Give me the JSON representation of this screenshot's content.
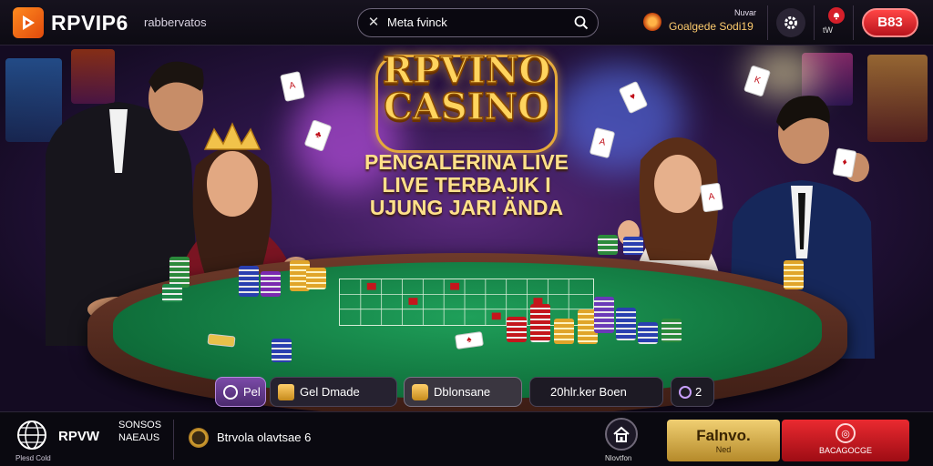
{
  "header": {
    "brand": "RPVIP6",
    "brand_sub": "rabbervatos",
    "search_value": "Meta fvinck",
    "promo_top": "Nuvar",
    "promo_text": "Goalgede Sodi19",
    "bell_label": "tW",
    "pill_label": "B83"
  },
  "hero": {
    "title_line1": "RPVINO",
    "title_line2": "CASINO",
    "tagline": [
      "PENGALERINA LIVE",
      "LIVE TERBAJIK I",
      "UJUNG JARI ÄNDA"
    ],
    "buttons": [
      {
        "label": "Pel"
      },
      {
        "label": "Gel Dmade"
      },
      {
        "label": "Dblonsane"
      },
      {
        "label": "20hlr.ker Boen"
      },
      {
        "label": "2"
      }
    ]
  },
  "footer": {
    "brand": "RPVW",
    "globe_caption": "Plesd Cold",
    "col2_line1": "SONSOS",
    "col2_line2": "NAEAUS",
    "message": "Btrvola olavtsae 6",
    "home_caption": "Nlovtfon",
    "gold_button_l1": "Falnvo.",
    "gold_button_l2": "Ned",
    "red_button_l2": "BACAGOCGE"
  },
  "colors": {
    "accent_orange": "#e14a0c",
    "title_gold": "#ffd45e",
    "felt_green": "#0f6e3a",
    "cta_red": "#d61f2a",
    "cta_gold": "#d9b24e"
  },
  "icons": [
    "play-logo-icon",
    "close-icon",
    "search-icon",
    "gear-icon",
    "bell-icon",
    "globe-icon",
    "coin-icon",
    "home-icon"
  ]
}
